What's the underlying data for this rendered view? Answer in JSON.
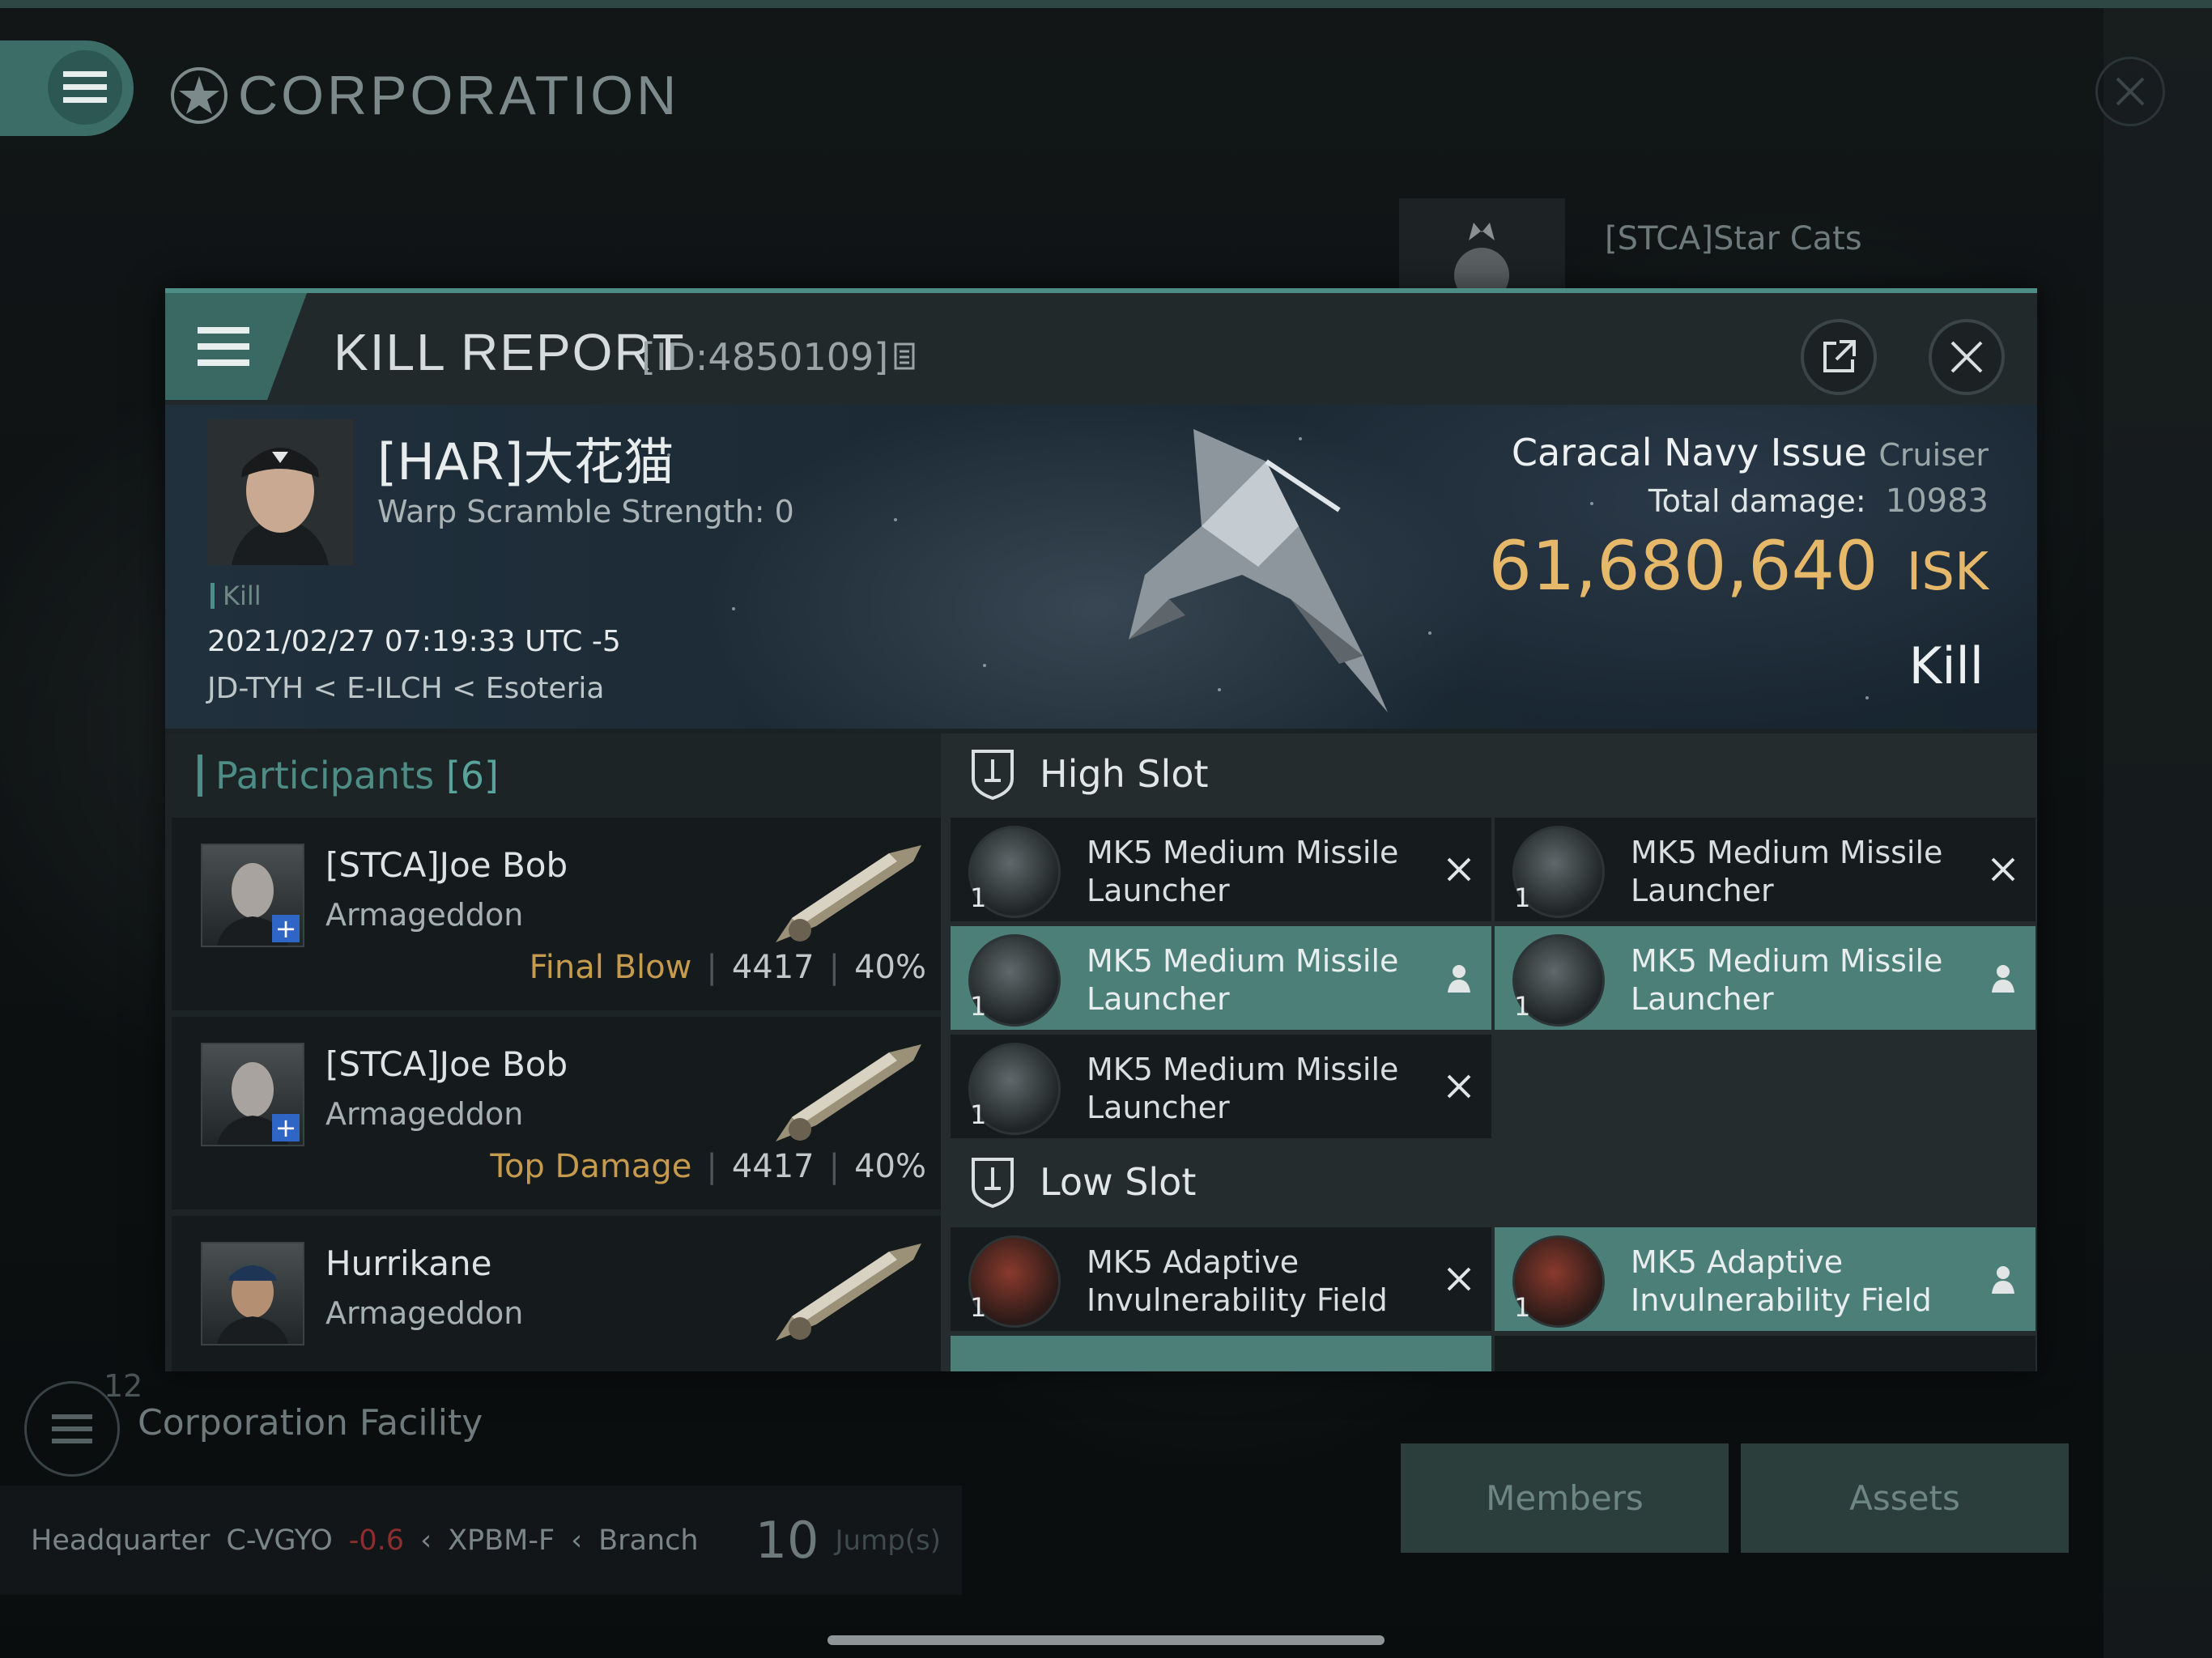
{
  "corp_page": {
    "title": "CORPORATION",
    "stca_name": "[STCA]Star Cats",
    "facility_count": "12",
    "facility_label": "Corporation Facility",
    "hq": {
      "label": "Headquarter",
      "system": "C-VGYO",
      "security": "-0.6",
      "route1": "XPBM-F",
      "route2": "Branch",
      "jumps": "10",
      "jumps_unit": "Jump(s)"
    },
    "tabs": {
      "members": "Members",
      "assets": "Assets"
    }
  },
  "kill_report": {
    "title": "KILL REPORT",
    "id": "[ID:4850109]",
    "victim": {
      "name": "[HAR]大花猫",
      "warp_scramble": "Warp Scramble Strength: 0",
      "tag": "Kill",
      "time": "2021/02/27 07:19:33 UTC -5",
      "location": "JD-TYH < E-ILCH < Esoteria"
    },
    "ship": {
      "name": "Caracal Navy Issue",
      "class": "Cruiser",
      "total_damage_label": "Total damage:",
      "total_damage": "10983",
      "isk_value": "61,680,640",
      "isk_unit": "ISK",
      "result": "Kill"
    },
    "participants": {
      "label": "Participants",
      "count": "[6]",
      "rows": [
        {
          "name": "[STCA]Joe Bob",
          "ship": "Armageddon",
          "role": "Final Blow",
          "damage": "4417",
          "percent": "40%"
        },
        {
          "name": "[STCA]Joe Bob",
          "ship": "Armageddon",
          "role": "Top Damage",
          "damage": "4417",
          "percent": "40%"
        },
        {
          "name": "Hurrikane",
          "ship": "Armageddon",
          "role": "",
          "damage": "",
          "percent": ""
        }
      ]
    },
    "high_slot": {
      "label": "High Slot",
      "items": [
        {
          "name": "MK5 Medium Missile Launcher",
          "qty": "1",
          "state": "destroyed"
        },
        {
          "name": "MK5 Medium Missile Launcher",
          "qty": "1",
          "state": "destroyed"
        },
        {
          "name": "MK5 Medium Missile Launcher",
          "qty": "1",
          "state": "dropped"
        },
        {
          "name": "MK5 Medium Missile Launcher",
          "qty": "1",
          "state": "dropped"
        },
        {
          "name": "MK5 Medium Missile Launcher",
          "qty": "1",
          "state": "destroyed"
        }
      ]
    },
    "low_slot": {
      "label": "Low Slot",
      "items": [
        {
          "name": "MK5 Adaptive Invulnerability Field",
          "qty": "1",
          "state": "destroyed"
        },
        {
          "name": "MK5 Adaptive Invulnerability Field",
          "qty": "1",
          "state": "dropped"
        }
      ]
    },
    "colors": {
      "accent": "#4e8d86",
      "isk": "#e6b86a",
      "role": "#c79b4d",
      "dropped_bg": "#4d7f79"
    }
  }
}
